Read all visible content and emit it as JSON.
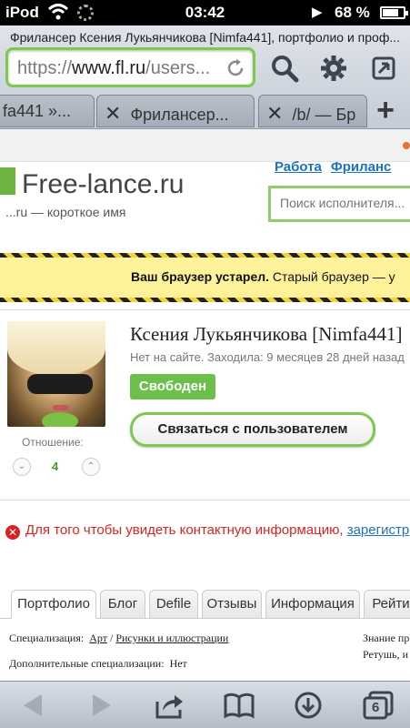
{
  "status": {
    "carrier": "iPod",
    "time": "03:42",
    "battery": "68 %"
  },
  "browser": {
    "page_title": "Фрилансер Ксения Лукьянчикова [Nimfa441], портфолио и проф...",
    "url_prefix": "https://",
    "url_host": "www.fl.ru",
    "url_path": "/users...",
    "tabs": [
      {
        "label": "fa441 »..."
      },
      {
        "label": "Фрилансер..."
      },
      {
        "label": "/b/ — Бр"
      }
    ]
  },
  "site": {
    "logo": "Free-lance.ru",
    "tagline": "...ru — короткое имя",
    "top_links": [
      "Работа",
      "Фриланс"
    ],
    "search_placeholder": "Поиск исполнителя..."
  },
  "warning": {
    "bold": "Ваш браузер устарел.",
    "text": " Старый браузер — у"
  },
  "profile": {
    "name": "Ксения Лукьянчикова [Nimfa441]",
    "last_seen": "Нет на сайте. Заходила: 9 месяцев 28 дней назад",
    "status_badge": "Свободен",
    "contact_button": "Связаться с пользователем",
    "relation_label": "Отношение:",
    "relation_count": "4"
  },
  "notice": {
    "text": "Для того чтобы увидеть контактную информацию, ",
    "link": "зарегистр"
  },
  "profile_tabs": [
    "Портфолио",
    "Блог",
    "Defile",
    "Отзывы",
    "Информация",
    "Рейти"
  ],
  "specialization": {
    "label": "Специализация:",
    "main": "Арт",
    "separator": " / ",
    "sub": "Рисунки и иллюстрации",
    "extra_label": "Дополнительные специализации:",
    "extra_value": "Нет",
    "right_line1": "Знание пр",
    "right_line2": "Ретушь, и"
  },
  "toolbar": {
    "tabs_count": "6"
  }
}
